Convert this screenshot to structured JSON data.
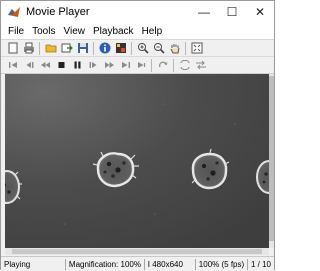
{
  "window": {
    "title": "Movie Player",
    "controls": {
      "minimize": "—",
      "maximize": "☐",
      "close": "✕"
    }
  },
  "menu": [
    "File",
    "Tools",
    "View",
    "Playback",
    "Help"
  ],
  "toolbar1": {
    "icons": [
      "new-icon",
      "print-icon",
      "open-folder-icon",
      "export-icon",
      "save-icon",
      "info-icon",
      "colormap-icon",
      "zoom-in-icon",
      "zoom-out-icon",
      "pan-hand-icon",
      "fit-to-window-icon"
    ]
  },
  "toolbar2": {
    "icons": [
      "go-to-first-icon",
      "step-back-icon",
      "rewind-icon",
      "stop-icon",
      "pause-icon",
      "step-forward-icon",
      "fast-forward-icon",
      "go-to-last-icon",
      "jump-to-icon",
      "loop-icon",
      "forward-backward-icon"
    ]
  },
  "status": {
    "state": "Playing",
    "magnification": "Magnification: 100%",
    "frame_size": "I 480x640",
    "frame_rate": "100% (5 fps)",
    "frame_counter": "1 / 10"
  },
  "colors": {
    "video_background": "#4b4b4b",
    "cell": "#d8d8d8"
  }
}
